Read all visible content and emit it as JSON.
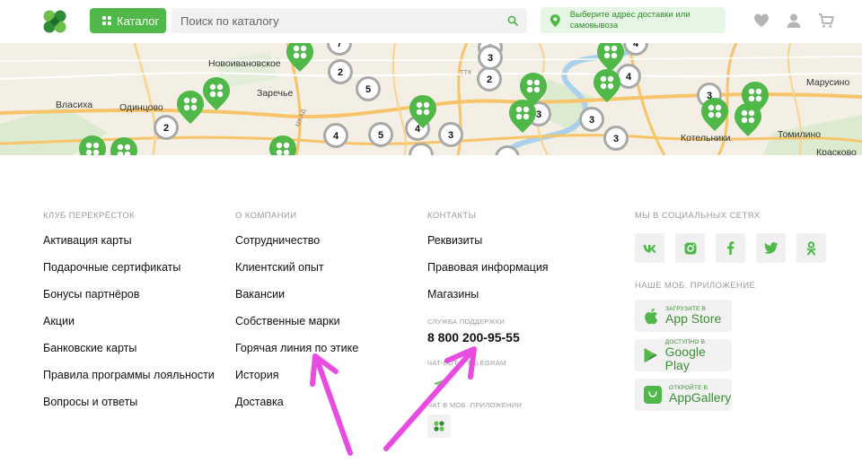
{
  "header": {
    "catalog_label": "Каталог",
    "search_placeholder": "Поиск по каталогу",
    "address_label": "Выберите адрес доставки или самовывоза",
    "brand_color": "#4fb848"
  },
  "map": {
    "labels": [
      "Новоивановское",
      "Заречье",
      "Власиха",
      "Одинцово",
      "Котельники",
      "Томилино",
      "Марусино",
      "Красково",
      "ТТК",
      "МКАД"
    ],
    "markers": [
      "7",
      "3",
      "2",
      "5",
      "2",
      "4",
      "5",
      "4",
      "3",
      "3",
      "3",
      "3",
      "4",
      "3",
      "3",
      "2",
      "3"
    ]
  },
  "footer": {
    "club": {
      "title": "КЛУБ ПЕРЕКРЁСТОК",
      "links": [
        "Активация карты",
        "Подарочные сертификаты",
        "Бонусы партнёров",
        "Акции",
        "Банковские карты",
        "Правила программы лояльности",
        "Вопросы и ответы"
      ]
    },
    "company": {
      "title": "О КОМПАНИИ",
      "links": [
        "Сотрудничество",
        "Клиентский опыт",
        "Вакансии",
        "Собственные марки",
        "Горячая линия по этике",
        "История",
        "Доставка"
      ]
    },
    "contacts": {
      "title": "КОНТАКТЫ",
      "links": [
        "Реквизиты",
        "Правовая информация",
        "Магазины"
      ],
      "support_title": "СЛУЖБА ПОДДЕРЖКИ",
      "phone": "8 800 200-95-55",
      "telegram_title": "ЧАТ-БОТ В TELEGRAM",
      "app_chat_title": "ЧАТ В МОБ. ПРИЛОЖЕНИИ"
    },
    "social": {
      "title": "МЫ В СОЦИАЛЬНЫХ СЕТЯХ",
      "icons": [
        "vk-icon",
        "instagram-icon",
        "facebook-icon",
        "twitter-icon",
        "odnoklassniki-icon"
      ],
      "app_title": "НАШЕ МОБ. ПРИЛОЖЕНИЕ",
      "stores": [
        {
          "small": "Загрузите в",
          "big": "App Store"
        },
        {
          "small": "Доступно в",
          "big": "Google Play"
        },
        {
          "small": "Откройте в",
          "big": "AppGallery"
        }
      ]
    }
  },
  "colors": {
    "green": "#4fb848",
    "annotation": "#e84be0"
  }
}
